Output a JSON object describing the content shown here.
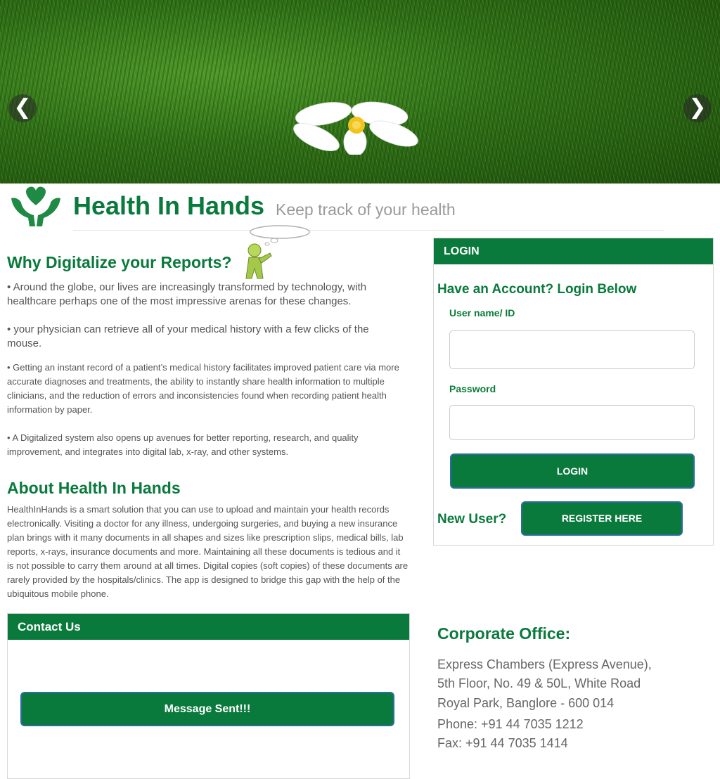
{
  "banner": {
    "prev_arrow": "❮",
    "next_arrow": "❯"
  },
  "header": {
    "site_title": "Health In Hands",
    "tagline": "Keep track of your health"
  },
  "why": {
    "heading": "Why Digitalize your Reports?",
    "points": [
      "•  Around the globe, our lives are increasingly transformed by technology, with healthcare perhaps one of the most impressive arenas for these changes.",
      "•  your physician can retrieve all of your medical history with a few clicks of the mouse.",
      "•  Getting an instant record of a patient’s medical history facilitates improved patient care via more accurate diagnoses and treatments, the ability to instantly share health information to multiple clinicians, and the reduction of errors and inconsistencies found when recording patient health information by paper.",
      "•  A Digitalized system also opens up avenues for better reporting, research, and quality improvement, and integrates into digital lab, x-ray, and other systems."
    ]
  },
  "about": {
    "heading": "About Health In Hands",
    "text": "HealthInHands is a smart solution that you can use to upload and maintain your health records electronically. Visiting a doctor for any illness, undergoing surgeries, and buying a new insurance plan brings with it many documents in all shapes and sizes like prescription slips, medical bills, lab reports, x-rays, insurance documents and more. Maintaining all these documents is tedious and it is not possible to carry them around at all times. Digital copies (soft copies) of these documents are rarely provided by the hospitals/clinics. The app is designed to bridge this gap with the help of the ubiquitous mobile phone."
  },
  "login": {
    "header": "LOGIN",
    "subheading": "Have an Account? Login Below",
    "username_label": "User name/ ID",
    "username_value": "",
    "password_label": "Password",
    "password_value": "",
    "login_button": "LOGIN",
    "new_user_label": "New User?",
    "register_button": "REGISTER HERE"
  },
  "contact": {
    "header": "Contact Us",
    "message_button": "Message Sent!!!"
  },
  "corporate": {
    "title": "Corporate Office:",
    "lines": [
      "Express Chambers (Express Avenue),",
      "5th Floor, No. 49 & 50L, White Road",
      "Royal Park, Banglore - 600 014",
      "Phone: +91 44 7035 1212",
      "Fax: +91 44 7035 1414"
    ]
  },
  "colors": {
    "brand_green": "#0a7a3c",
    "muted_text": "#555555",
    "tagline_gray": "#9a9a9a"
  }
}
